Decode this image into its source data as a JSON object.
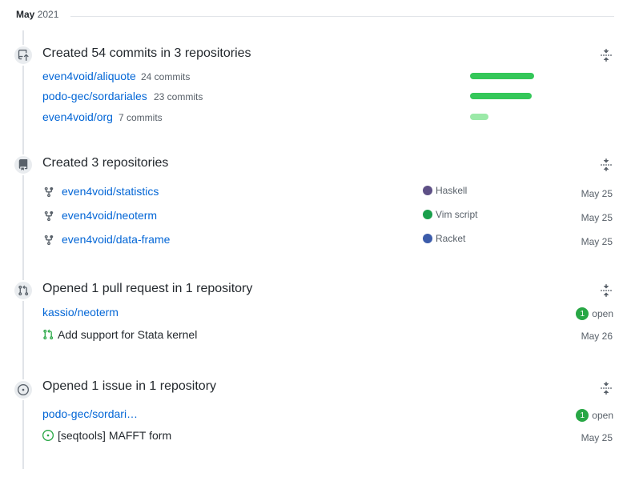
{
  "month": {
    "label": "May",
    "year": "2021"
  },
  "commits": {
    "title": "Created 54 commits in 3 repositories",
    "repos": [
      {
        "name": "even4void/aliquote",
        "count": "24 commits",
        "share": 1.0,
        "color": "#34c759"
      },
      {
        "name": "podo-gec/sordariales",
        "count": "23 commits",
        "share": 0.958,
        "color": "#34c759"
      },
      {
        "name": "even4void/org",
        "count": "7 commits",
        "share": 0.29,
        "color": "#9be9a8"
      }
    ]
  },
  "repositories": {
    "title": "Created 3 repositories",
    "repos": [
      {
        "name": "even4void/statistics",
        "language": "Haskell",
        "lang_color": "#5e5086",
        "date": "May 25"
      },
      {
        "name": "even4void/neoterm",
        "language": "Vim script",
        "lang_color": "#199f4b",
        "date": "May 25"
      },
      {
        "name": "even4void/data-frame",
        "language": "Racket",
        "lang_color": "#3c5caa",
        "date": "May 25"
      }
    ]
  },
  "pull_requests": {
    "title": "Opened 1 pull request in 1 repository",
    "repo": "kassio/neoterm",
    "count": "1",
    "status": "open",
    "item": "Add support for Stata kernel",
    "date": "May 26"
  },
  "issues": {
    "title": "Opened 1 issue in 1 repository",
    "repo": "podo-gec/sordari…",
    "count": "1",
    "status": "open",
    "item": "[seqtools] MAFFT form",
    "date": "May 25"
  },
  "icons": {
    "commit": "repo-push-icon",
    "repo": "repo-icon",
    "pr": "git-pull-request-icon",
    "issue": "issue-opened-icon",
    "fold": "fold-icon",
    "fork": "repo-forked-icon"
  },
  "colors": {
    "link": "#0366d6",
    "green": "#28a745",
    "muted": "#586069"
  }
}
